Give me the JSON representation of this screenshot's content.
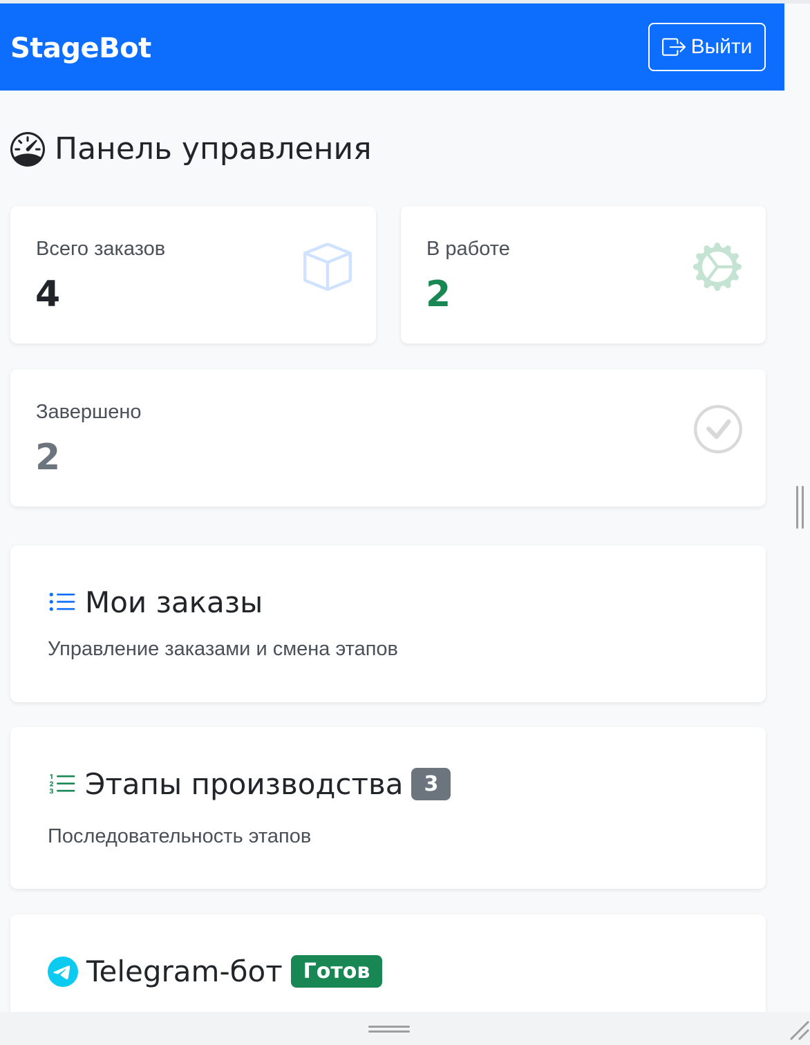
{
  "navbar": {
    "brand": "StageBot",
    "logout_label": "Выйти",
    "logout_icon": "box-arrow-right-icon",
    "bg_color": "#0d6efd"
  },
  "page": {
    "title": "Панель управления",
    "title_icon": "speedometer-icon"
  },
  "stats": [
    {
      "label": "Всего заказов",
      "value": "4",
      "icon": "box-icon",
      "color": "#212529"
    },
    {
      "label": "В работе",
      "value": "2",
      "icon": "gear-icon",
      "color": "#198754"
    },
    {
      "label": "Завершено",
      "value": "2",
      "icon": "check-circle-icon",
      "color": "#6c757d"
    }
  ],
  "menu": [
    {
      "title": "Мои заказы",
      "description": "Управление заказами и смена этапов",
      "icon": "list-icon"
    },
    {
      "title": "Этапы производства",
      "description": "Последовательность этапов",
      "icon": "list-ol-icon",
      "badge": "3",
      "badge_color": "#6c757d"
    },
    {
      "title": "Telegram-бот",
      "icon": "telegram-icon",
      "badge": "Готов",
      "badge_color": "#198754"
    }
  ]
}
